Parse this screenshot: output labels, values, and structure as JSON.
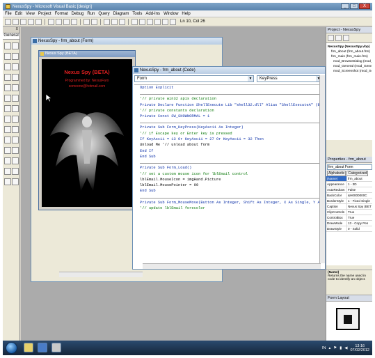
{
  "window": {
    "title": "NexusSpy - Microsoft Visual Basic [design]",
    "controls": [
      "_",
      "□",
      "X"
    ]
  },
  "menu": [
    "File",
    "Edit",
    "View",
    "Project",
    "Format",
    "Debug",
    "Run",
    "Query",
    "Diagram",
    "Tools",
    "Add-Ins",
    "Window",
    "Help"
  ],
  "toolbar": {
    "coords": "Ln 10, Col 26"
  },
  "toolbox": {
    "tab": "General",
    "close": "X"
  },
  "form_window": {
    "title": "NexusSpy - frm_about (Form)",
    "form_title": "Nexus Spy (BETA)",
    "splash_title": "Nexus Spy (BETA)",
    "splash_by": "Programmed by: NexusFaro",
    "splash_mail": "someone@hotmail.com"
  },
  "code_window": {
    "title": "NexusSpy - frm_about (Code)",
    "object": "Form",
    "procedure": "KeyPress",
    "lines": [
      {
        "t": "Option Explicit",
        "k": "k"
      },
      {
        "t": "",
        "k": "sep"
      },
      {
        "t": "'// private win32 apis declaration",
        "k": "c"
      },
      {
        "t": "Private Declare Function ShellExecute Lib \"shell32.dll\" Alias \"ShellExecuteA\" (ByVal",
        "k": "k"
      },
      {
        "t": "'// private constants declaration",
        "k": "c"
      },
      {
        "t": "Private Const SW_SHOWNORMAL = 1",
        "k": "k"
      },
      {
        "t": "",
        "k": "sep"
      },
      {
        "t": "Private Sub Form_KeyPress(KeyAscii As Integer)",
        "k": "k"
      },
      {
        "t": "    '// if Escape key or Enter key is pressed",
        "k": "c"
      },
      {
        "t": "    If KeyAscii = 13 Or KeyAscii = 27 Or KeyAscii = 32 Then",
        "k": "k"
      },
      {
        "t": "        Unload Me    '// unload about form",
        "k": "n"
      },
      {
        "t": "    End If",
        "k": "k"
      },
      {
        "t": "End Sub",
        "k": "k"
      },
      {
        "t": "",
        "k": "sep"
      },
      {
        "t": "Private Sub Form_Load()",
        "k": "k"
      },
      {
        "t": "    '// set a custom mouse icon for lblEmail control",
        "k": "c"
      },
      {
        "t": "    lblEmail.MouseIcon = imgHand.Picture",
        "k": "n"
      },
      {
        "t": "    lblEmail.MousePointer = 99",
        "k": "n"
      },
      {
        "t": "End Sub",
        "k": "k"
      },
      {
        "t": "",
        "k": "sep"
      },
      {
        "t": "Private Sub Form_MouseMove(Button As Integer, Shift As Integer, X As Single, Y As S",
        "k": "k"
      },
      {
        "t": "    '// update lblEmail forecolor",
        "k": "c"
      }
    ]
  },
  "project": {
    "title": "Project - NexusSpy",
    "items": [
      {
        "t": "NexusSpy (NexusSpy.vbp)",
        "c": "root"
      },
      {
        "t": "frm_about (frm_about.frm)",
        "c": "ind1"
      },
      {
        "t": "frm_main (frm_main.frm)",
        "c": "ind1"
      },
      {
        "t": "mod_BrowseDialog (mod_",
        "c": "ind2"
      },
      {
        "t": "mod_General (mod_Gene",
        "c": "ind2"
      },
      {
        "t": "mod_Screenshot (mod_Sc",
        "c": "ind2"
      }
    ]
  },
  "properties": {
    "title": "Properties - frm_about",
    "object": "frm_about Form",
    "tabs": [
      "Alphabetic",
      "Categorized"
    ],
    "rows": [
      {
        "n": "(Name)",
        "v": "frm_about"
      },
      {
        "n": "Appearance",
        "v": "1 - 3D"
      },
      {
        "n": "AutoRedraw",
        "v": "False"
      },
      {
        "n": "BackColor",
        "v": "&H0000000C"
      },
      {
        "n": "BorderStyle",
        "v": "1 - Fixed Single"
      },
      {
        "n": "Caption",
        "v": "Nexus Spy (BET"
      },
      {
        "n": "ClipControls",
        "v": "True"
      },
      {
        "n": "ControlBox",
        "v": "True"
      },
      {
        "n": "DrawMode",
        "v": "13 - Copy Pen"
      },
      {
        "n": "DrawStyle",
        "v": "0 - Solid"
      }
    ],
    "desc_title": "(Name)",
    "desc_text": "Returns the name used in code to identify an object."
  },
  "form_layout": {
    "title": "Form Layout"
  },
  "taskbar": {
    "lang": "IN",
    "time": "13:16",
    "date": "07/02/2012"
  }
}
